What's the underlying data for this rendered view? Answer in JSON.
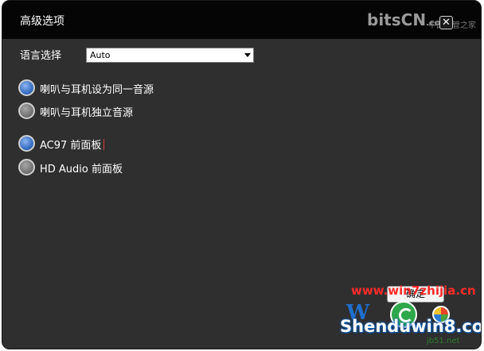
{
  "window": {
    "title": "高级选项",
    "close_label": "✕"
  },
  "brand": {
    "text": "bitsCN",
    "suffix": ".com",
    "subtext": "中国网管之家"
  },
  "language": {
    "label": "语言选择",
    "selected": "Auto"
  },
  "speaker_options": [
    {
      "label": "喇叭与耳机设为同一音源",
      "selected": true
    },
    {
      "label": "喇叭与耳机独立音源",
      "selected": false
    }
  ],
  "panel_options": [
    {
      "label": "AC97 前面板",
      "selected": true
    },
    {
      "label": "HD Audio 前面板",
      "selected": false
    }
  ],
  "ok_button": {
    "label": "确定"
  },
  "watermarks": {
    "site1": "www.win7zhijia.cn",
    "site2": "Shenduwin8.com",
    "site3": "jb51.net"
  },
  "colors": {
    "window_bg": "#2f2f2f",
    "titlebar_bg": "#050505",
    "radio_selected": "#3f74c8",
    "radio_unselected": "#757575"
  }
}
